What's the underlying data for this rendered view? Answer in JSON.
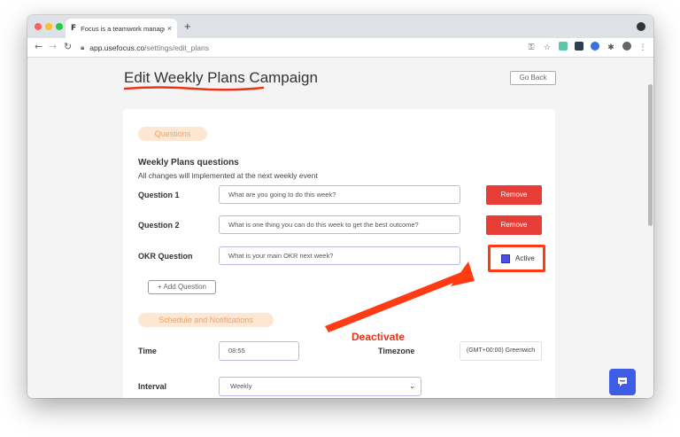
{
  "browser": {
    "tab_favicon": "F",
    "tab_title": "Focus is a teamwork managem",
    "tab_close": "×",
    "new_tab": "+",
    "url_domain": "app.usefocus.co",
    "url_path": "/settings/edit_plans"
  },
  "page": {
    "title": "Edit Weekly Plans Campaign",
    "go_back": "Go Back"
  },
  "questions_section": {
    "pill": "Questions",
    "heading": "Weekly Plans questions",
    "description": "All changes will implemented at the next weekly event",
    "questions": [
      {
        "label": "Question 1",
        "value": "What are you going to do this week?",
        "action": "Remove"
      },
      {
        "label": "Question 2",
        "value": "What is one thing you can do this week to get the best outcome?",
        "action": "Remove"
      }
    ],
    "okr": {
      "label": "OKR Question",
      "value": "What is your main OKR next week?",
      "toggle_label": "Active"
    },
    "add_question": "+ Add Question"
  },
  "schedule_section": {
    "pill": "Schedule and Notifications",
    "time_label": "Time",
    "time_value": "08:55",
    "timezone_label": "Timezone",
    "timezone_value": "(GMT+00:00) Greenwich",
    "interval_label": "Interval",
    "interval_value": "Weekly"
  },
  "annotation": {
    "text": "Deactivate",
    "color": "#e8341b"
  },
  "colors": {
    "accent": "#4a4fe4",
    "remove": "#e63e36",
    "pill_bg": "#fde7d3",
    "pill_text": "#f2a263",
    "chat": "#3f5ce6"
  }
}
